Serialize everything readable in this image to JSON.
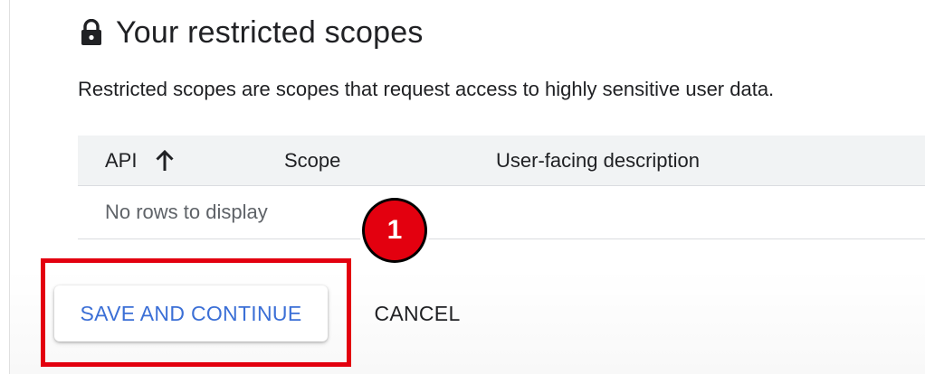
{
  "section": {
    "icon": "lock-icon",
    "title": "Your restricted scopes",
    "description": "Restricted scopes are scopes that request access to highly sensitive user data."
  },
  "table": {
    "columns": [
      "API",
      "Scope",
      "User-facing description"
    ],
    "sort_icon": "arrow-up-icon",
    "empty_message": "No rows to display"
  },
  "annotation": {
    "step_number": "1",
    "color": "#e3000f"
  },
  "actions": {
    "save_label": "SAVE AND CONTINUE",
    "cancel_label": "CANCEL",
    "accent_color": "#3b6fd6"
  }
}
